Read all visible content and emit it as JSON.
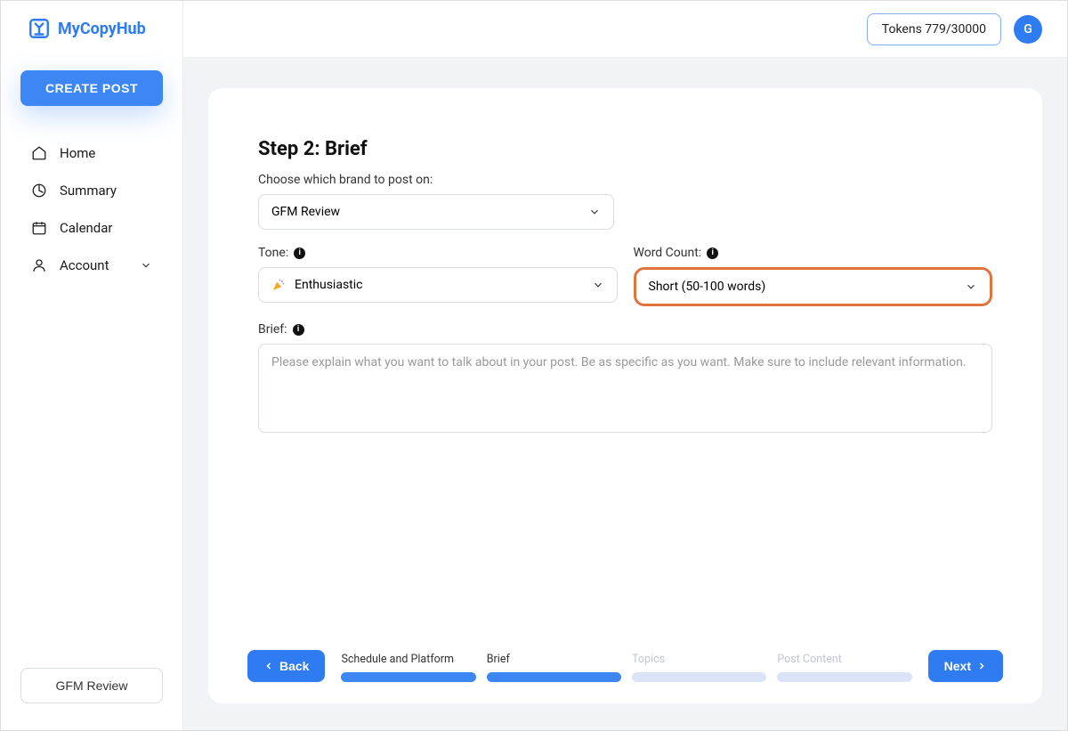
{
  "brand": {
    "name": "MyCopyHub"
  },
  "header": {
    "tokens_label": "Tokens 779/30000",
    "avatar_initial": "G"
  },
  "sidebar": {
    "create_post_label": "CREATE POST",
    "items": [
      {
        "id": "home",
        "label": "Home",
        "icon": "home-icon"
      },
      {
        "id": "summary",
        "label": "Summary",
        "icon": "summary-icon"
      },
      {
        "id": "calendar",
        "label": "Calendar",
        "icon": "calendar-icon"
      },
      {
        "id": "account",
        "label": "Account",
        "icon": "account-icon",
        "has_submenu": true
      }
    ],
    "footer_brand_label": "GFM Review"
  },
  "main": {
    "step_title": "Step 2: Brief",
    "brand_field_label": "Choose which brand to post on:",
    "brand_selected": "GFM Review",
    "tone_label": "Tone:",
    "tone_selected": "Enthusiastic",
    "wordcount_label": "Word Count:",
    "wordcount_selected": "Short (50-100 words)",
    "brief_label": "Brief:",
    "brief_placeholder": "Please explain what you want to talk about in your post. Be as specific as you want. Make sure to include relevant information."
  },
  "stepper": {
    "back_label": "Back",
    "next_label": "Next",
    "steps": [
      {
        "label": "Schedule and Platform",
        "active": true
      },
      {
        "label": "Brief",
        "active": true
      },
      {
        "label": "Topics",
        "active": false
      },
      {
        "label": "Post Content",
        "active": false
      }
    ]
  }
}
